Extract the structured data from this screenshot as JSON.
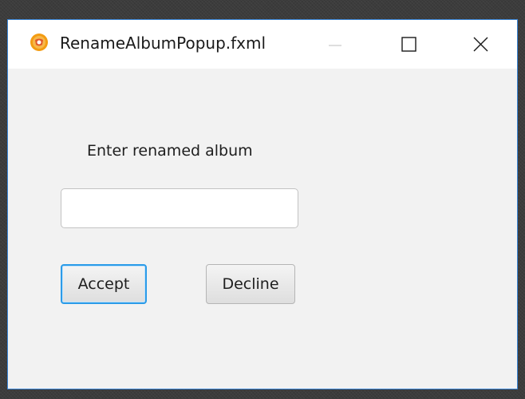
{
  "window": {
    "title": "RenameAlbumPopup.fxml",
    "icon": "java-app-icon",
    "controls": {
      "minimize": "minimize-icon",
      "maximize": "maximize-icon",
      "close": "close-icon"
    }
  },
  "form": {
    "prompt": "Enter renamed album",
    "input_value": "",
    "accept_label": "Accept",
    "decline_label": "Decline"
  },
  "colors": {
    "window_border": "#3a86d8",
    "focus_ring": "#2b9be8",
    "content_bg": "#f2f2f2",
    "icon_orange": "#f39c12"
  }
}
